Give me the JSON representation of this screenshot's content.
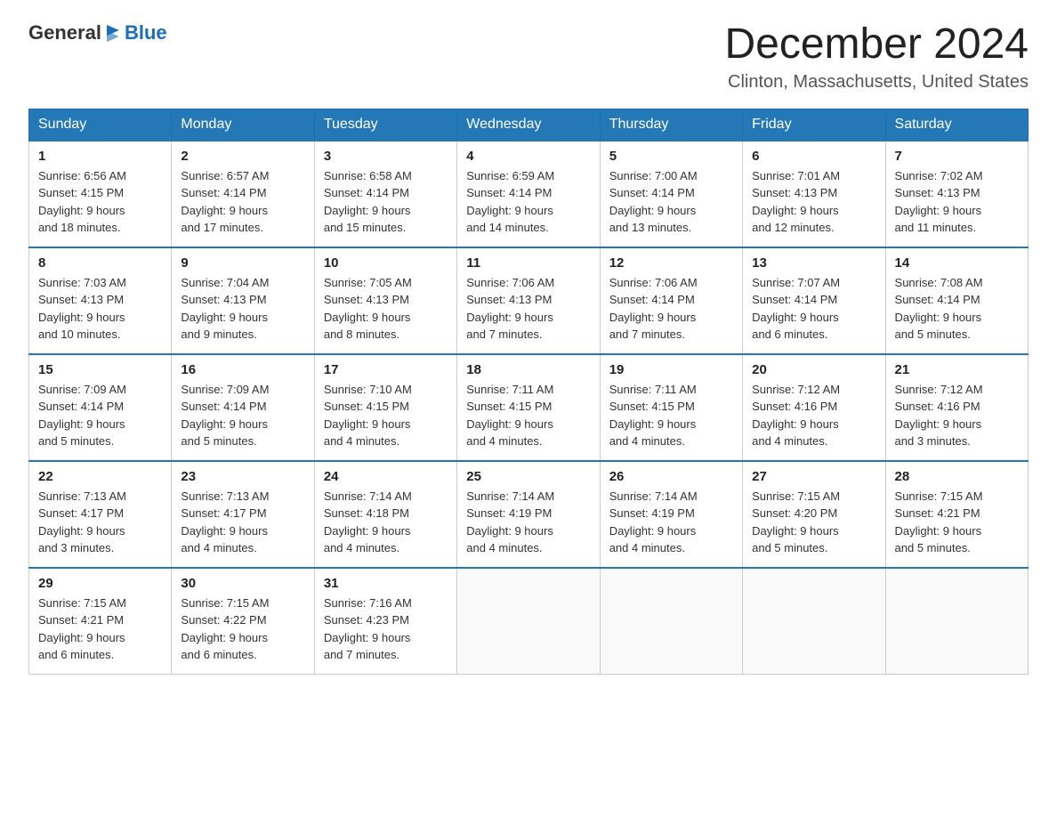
{
  "header": {
    "logo_general": "General",
    "logo_blue": "Blue",
    "month_title": "December 2024",
    "location": "Clinton, Massachusetts, United States"
  },
  "weekdays": [
    "Sunday",
    "Monday",
    "Tuesday",
    "Wednesday",
    "Thursday",
    "Friday",
    "Saturday"
  ],
  "weeks": [
    [
      {
        "day": "1",
        "sunrise": "6:56 AM",
        "sunset": "4:15 PM",
        "daylight": "9 hours and 18 minutes."
      },
      {
        "day": "2",
        "sunrise": "6:57 AM",
        "sunset": "4:14 PM",
        "daylight": "9 hours and 17 minutes."
      },
      {
        "day": "3",
        "sunrise": "6:58 AM",
        "sunset": "4:14 PM",
        "daylight": "9 hours and 15 minutes."
      },
      {
        "day": "4",
        "sunrise": "6:59 AM",
        "sunset": "4:14 PM",
        "daylight": "9 hours and 14 minutes."
      },
      {
        "day": "5",
        "sunrise": "7:00 AM",
        "sunset": "4:14 PM",
        "daylight": "9 hours and 13 minutes."
      },
      {
        "day": "6",
        "sunrise": "7:01 AM",
        "sunset": "4:13 PM",
        "daylight": "9 hours and 12 minutes."
      },
      {
        "day": "7",
        "sunrise": "7:02 AM",
        "sunset": "4:13 PM",
        "daylight": "9 hours and 11 minutes."
      }
    ],
    [
      {
        "day": "8",
        "sunrise": "7:03 AM",
        "sunset": "4:13 PM",
        "daylight": "9 hours and 10 minutes."
      },
      {
        "day": "9",
        "sunrise": "7:04 AM",
        "sunset": "4:13 PM",
        "daylight": "9 hours and 9 minutes."
      },
      {
        "day": "10",
        "sunrise": "7:05 AM",
        "sunset": "4:13 PM",
        "daylight": "9 hours and 8 minutes."
      },
      {
        "day": "11",
        "sunrise": "7:06 AM",
        "sunset": "4:13 PM",
        "daylight": "9 hours and 7 minutes."
      },
      {
        "day": "12",
        "sunrise": "7:06 AM",
        "sunset": "4:14 PM",
        "daylight": "9 hours and 7 minutes."
      },
      {
        "day": "13",
        "sunrise": "7:07 AM",
        "sunset": "4:14 PM",
        "daylight": "9 hours and 6 minutes."
      },
      {
        "day": "14",
        "sunrise": "7:08 AM",
        "sunset": "4:14 PM",
        "daylight": "9 hours and 5 minutes."
      }
    ],
    [
      {
        "day": "15",
        "sunrise": "7:09 AM",
        "sunset": "4:14 PM",
        "daylight": "9 hours and 5 minutes."
      },
      {
        "day": "16",
        "sunrise": "7:09 AM",
        "sunset": "4:14 PM",
        "daylight": "9 hours and 5 minutes."
      },
      {
        "day": "17",
        "sunrise": "7:10 AM",
        "sunset": "4:15 PM",
        "daylight": "9 hours and 4 minutes."
      },
      {
        "day": "18",
        "sunrise": "7:11 AM",
        "sunset": "4:15 PM",
        "daylight": "9 hours and 4 minutes."
      },
      {
        "day": "19",
        "sunrise": "7:11 AM",
        "sunset": "4:15 PM",
        "daylight": "9 hours and 4 minutes."
      },
      {
        "day": "20",
        "sunrise": "7:12 AM",
        "sunset": "4:16 PM",
        "daylight": "9 hours and 4 minutes."
      },
      {
        "day": "21",
        "sunrise": "7:12 AM",
        "sunset": "4:16 PM",
        "daylight": "9 hours and 3 minutes."
      }
    ],
    [
      {
        "day": "22",
        "sunrise": "7:13 AM",
        "sunset": "4:17 PM",
        "daylight": "9 hours and 3 minutes."
      },
      {
        "day": "23",
        "sunrise": "7:13 AM",
        "sunset": "4:17 PM",
        "daylight": "9 hours and 4 minutes."
      },
      {
        "day": "24",
        "sunrise": "7:14 AM",
        "sunset": "4:18 PM",
        "daylight": "9 hours and 4 minutes."
      },
      {
        "day": "25",
        "sunrise": "7:14 AM",
        "sunset": "4:19 PM",
        "daylight": "9 hours and 4 minutes."
      },
      {
        "day": "26",
        "sunrise": "7:14 AM",
        "sunset": "4:19 PM",
        "daylight": "9 hours and 4 minutes."
      },
      {
        "day": "27",
        "sunrise": "7:15 AM",
        "sunset": "4:20 PM",
        "daylight": "9 hours and 5 minutes."
      },
      {
        "day": "28",
        "sunrise": "7:15 AM",
        "sunset": "4:21 PM",
        "daylight": "9 hours and 5 minutes."
      }
    ],
    [
      {
        "day": "29",
        "sunrise": "7:15 AM",
        "sunset": "4:21 PM",
        "daylight": "9 hours and 6 minutes."
      },
      {
        "day": "30",
        "sunrise": "7:15 AM",
        "sunset": "4:22 PM",
        "daylight": "9 hours and 6 minutes."
      },
      {
        "day": "31",
        "sunrise": "7:16 AM",
        "sunset": "4:23 PM",
        "daylight": "9 hours and 7 minutes."
      },
      null,
      null,
      null,
      null
    ]
  ],
  "labels": {
    "sunrise": "Sunrise:",
    "sunset": "Sunset:",
    "daylight": "Daylight:"
  }
}
